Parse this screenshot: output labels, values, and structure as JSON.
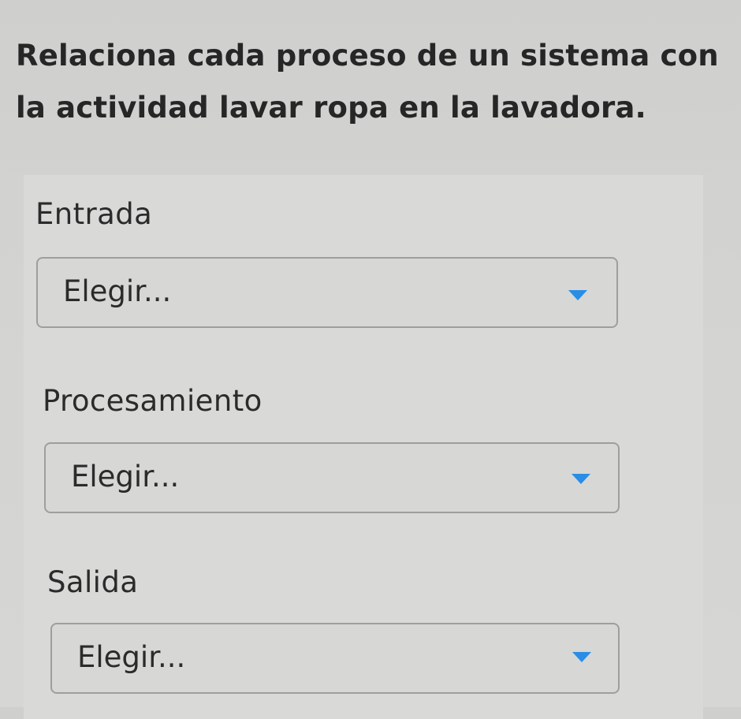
{
  "question": "Relaciona cada proceso de un sistema con la actividad lavar ropa en la lavadora.",
  "colors": {
    "caret": "#2a8de6",
    "text": "#262626"
  },
  "fields": [
    {
      "label": "Entrada",
      "selected": "Elegir...",
      "icon": "chevron-down-icon"
    },
    {
      "label": "Procesamiento",
      "selected": "Elegir...",
      "icon": "chevron-down-icon"
    },
    {
      "label": "Salida",
      "selected": "Elegir...",
      "icon": "chevron-down-icon"
    }
  ]
}
